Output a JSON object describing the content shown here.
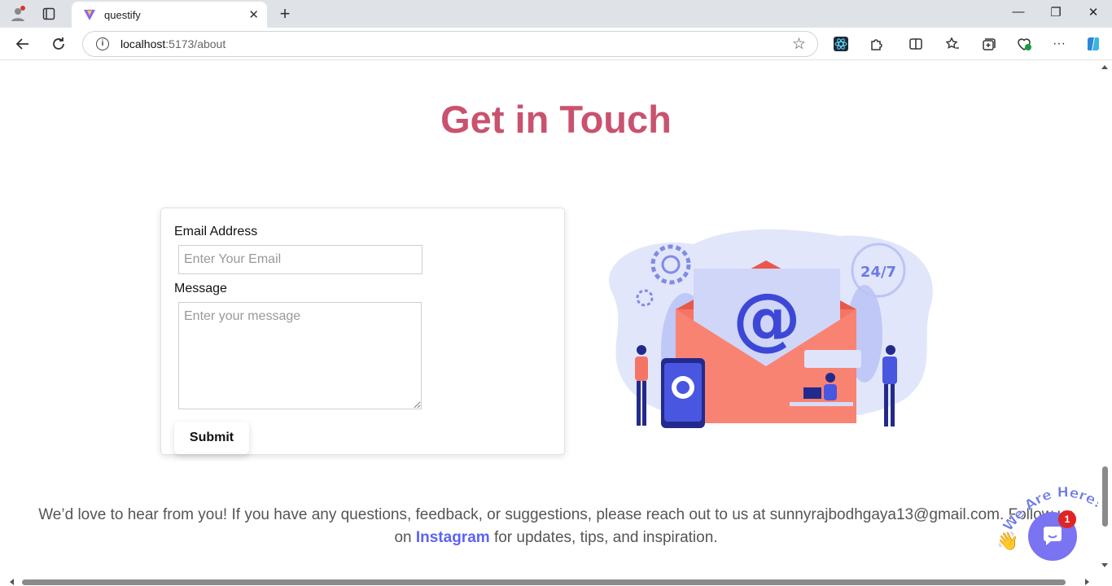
{
  "browser": {
    "tab_title": "questify",
    "address_host": "localhost",
    "address_path": ":5173/about"
  },
  "page": {
    "heading": "Get in Touch",
    "form": {
      "email_label": "Email Address",
      "email_placeholder": "Enter Your Email",
      "message_label": "Message",
      "message_placeholder": "Enter your message",
      "submit_label": "Submit"
    },
    "footer": {
      "text_before": "We’d love to hear from you! If you have any questions, feedback, or suggestions, please reach out to us at sunnyrajbodhgaya13@gmail.com. Follow us on ",
      "link_label": "Instagram",
      "text_after": " for updates, tips, and inspiration."
    },
    "chat_widget": {
      "banner_text": "We Are Here!",
      "badge_count": "1"
    },
    "illustration": {
      "badge_text": "24/7"
    }
  },
  "colors": {
    "heading": "#c9526f",
    "link": "#5b63f5",
    "chat": "#7a73f2"
  }
}
